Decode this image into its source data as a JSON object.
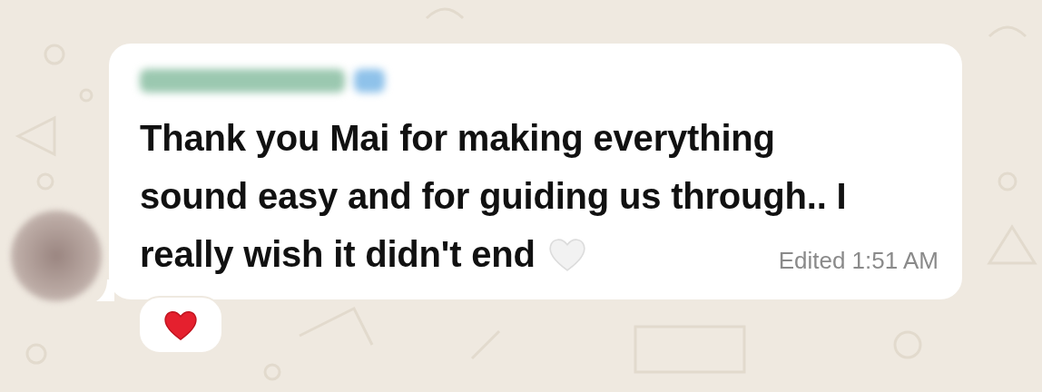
{
  "message": {
    "text_lines": [
      "Thank you Mai for making everything",
      "sound easy and for guiding us through.. I",
      "really wish it didn't end"
    ],
    "edited_label": "Edited",
    "time": "1:51 AM"
  }
}
